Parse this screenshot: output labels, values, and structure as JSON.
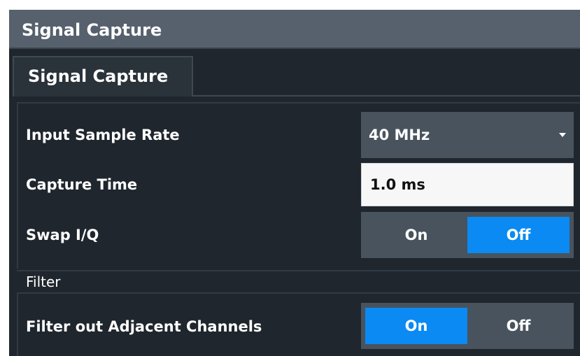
{
  "dialog": {
    "title": "Signal Capture",
    "tab_label": "Signal Capture"
  },
  "input_sample_rate": {
    "label": "Input Sample Rate",
    "value": "40 MHz"
  },
  "capture_time": {
    "label": "Capture Time",
    "value": "1.0 ms"
  },
  "swap_iq": {
    "label": "Swap I/Q",
    "on_label": "On",
    "off_label": "Off",
    "selected": "Off"
  },
  "filter": {
    "section_label": "Filter",
    "adjacent_label": "Filter out Adjacent Channels",
    "on_label": "On",
    "off_label": "Off",
    "selected": "On"
  },
  "colors": {
    "accent": "#0a8af2",
    "title_bar": "#56616d",
    "panel_bg": "#1f262d",
    "control_bg": "#48535e"
  },
  "icons": {
    "dropdown": "chevron-down-icon"
  }
}
